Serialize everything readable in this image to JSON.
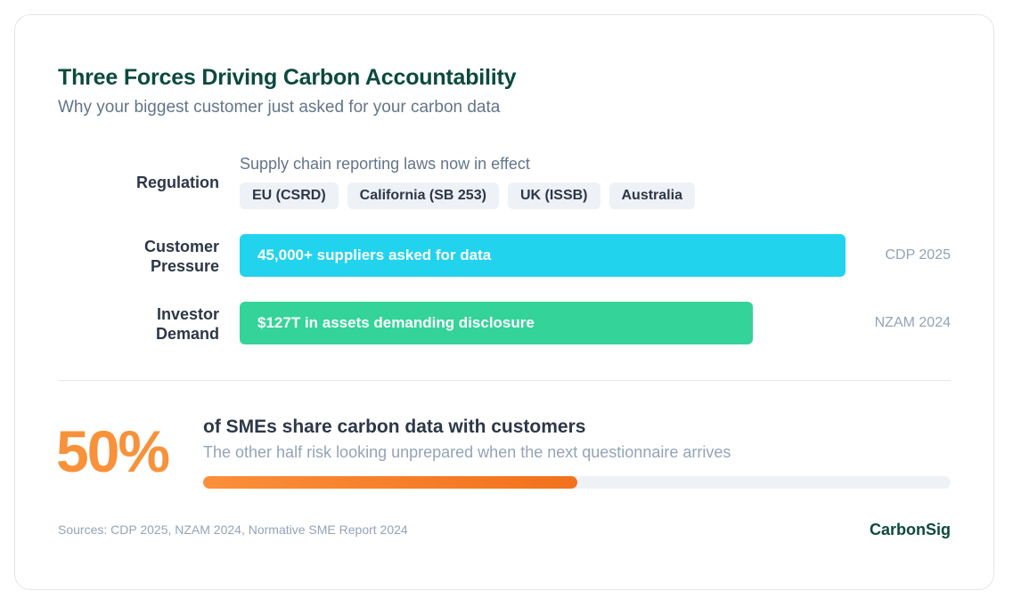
{
  "header": {
    "title": "Three Forces Driving Carbon Accountability",
    "subtitle": "Why your biggest customer just asked for your carbon data"
  },
  "regulation": {
    "label": "Regulation",
    "caption": "Supply chain reporting laws now in effect",
    "chips": [
      "EU (CSRD)",
      "California (SB 253)",
      "UK (ISSB)",
      "Australia"
    ]
  },
  "chart_data": {
    "type": "bar",
    "orientation": "horizontal",
    "categories": [
      "Customer\nPressure",
      "Investor\nDemand"
    ],
    "bars": [
      {
        "label": "45,000+ suppliers asked for data",
        "value": 45000,
        "relative_length": 0.85,
        "color": "#22d3ee",
        "source": "CDP 2025"
      },
      {
        "label": "$127T in assets demanding disclosure",
        "value": 127,
        "relative_length": 0.72,
        "color": "#34d399",
        "source": "NZAM 2024"
      }
    ]
  },
  "stat": {
    "value": "50%",
    "percent": 50,
    "headline": "of SMEs share carbon data with customers",
    "sub": "The other half risk looking unprepared when the next questionnaire arrives",
    "accent": "#f7923a"
  },
  "footer": {
    "sources": "Sources: CDP 2025, NZAM 2024, Normative SME Report 2024",
    "brand": "CarbonSig"
  }
}
